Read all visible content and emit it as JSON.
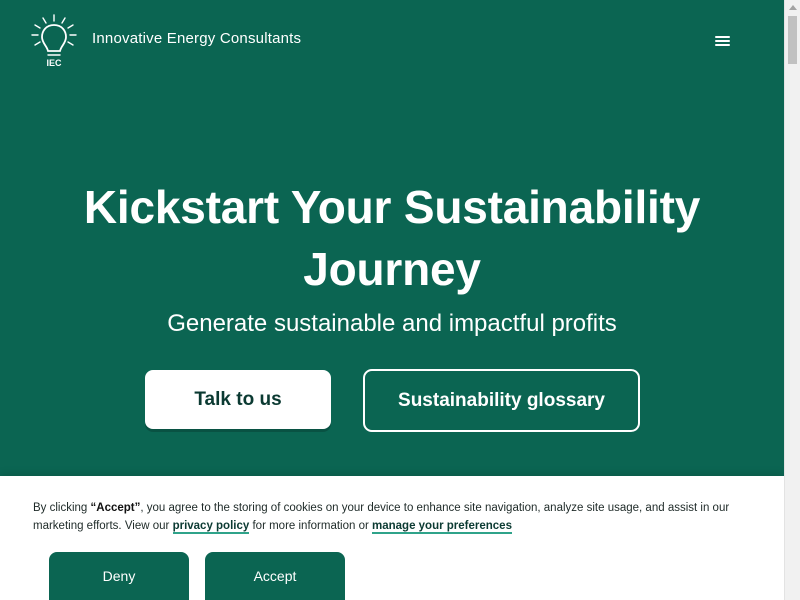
{
  "header": {
    "brand": "Innovative Energy Consultants",
    "logo_text": "IEC",
    "logo_icon": "lightbulb-icon",
    "menu_icon": "hamburger-menu-icon"
  },
  "hero": {
    "title": "Kickstart Your Sustainability Journey",
    "subtitle": "Generate sustainable and impactful profits",
    "primary_button": "Talk to us",
    "secondary_button": "Sustainability glossary"
  },
  "cookie_banner": {
    "text_1": "By clicking ",
    "accept_quote": "“Accept”",
    "text_2": ", you agree to the storing of cookies on your device to enhance site navigation, analyze site usage, and assist in our marketing efforts. View our ",
    "privacy_link": "privacy policy",
    "text_3": " for more information or ",
    "preferences_link": "manage your preferences",
    "deny_button": "Deny",
    "accept_button": "Accept"
  },
  "colors": {
    "brand_green": "#0b6552",
    "link_underline": "#2fa38a",
    "white": "#ffffff"
  }
}
